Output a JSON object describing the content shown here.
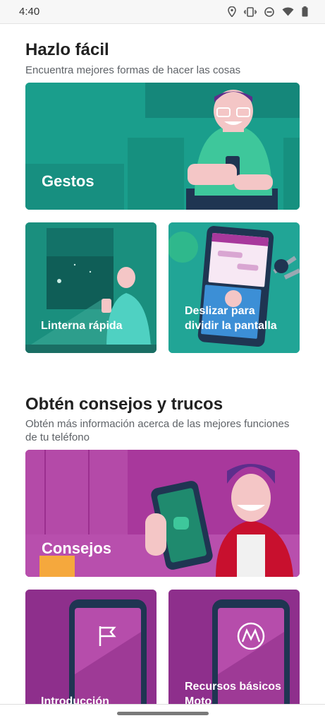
{
  "status_bar": {
    "time": "4:40",
    "icons": [
      "location-icon",
      "vibrate-icon",
      "do-not-disturb-icon",
      "wifi-icon",
      "battery-icon"
    ]
  },
  "sections": [
    {
      "title": "Hazlo fácil",
      "subtitle": "Encuentra mejores formas de hacer las cosas",
      "cards": [
        {
          "label": "Gestos",
          "color": "#1a9e8c"
        },
        {
          "label": "Linterna rápida",
          "color": "#1a8f7e"
        },
        {
          "label": "Deslizar para dividir la pantalla",
          "color": "#21a596"
        }
      ]
    },
    {
      "title": "Obtén consejos y trucos",
      "subtitle": "Obtén más información acerca de las mejores funciones de tu teléfono",
      "cards": [
        {
          "label": "Consejos",
          "color": "#a8389c"
        },
        {
          "label": "Introducción",
          "color": "#8e2f8c"
        },
        {
          "label": "Recursos básicos Moto",
          "color": "#8e2f8c"
        }
      ]
    }
  ]
}
